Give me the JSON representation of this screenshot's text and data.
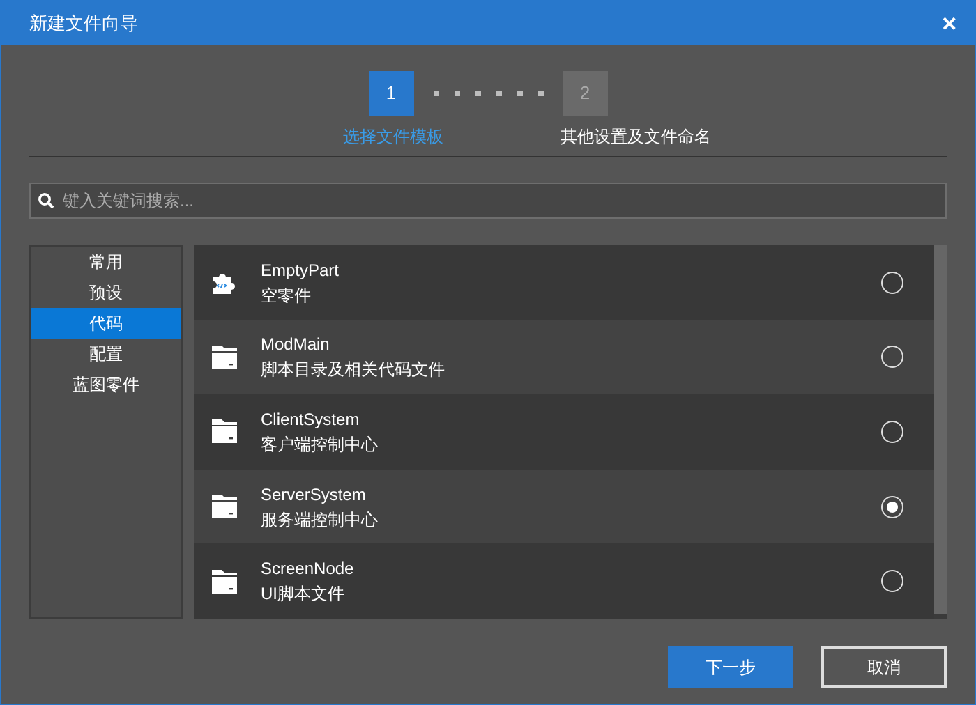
{
  "window": {
    "title": "新建文件向导",
    "close": "✕"
  },
  "steps": [
    {
      "number": "1",
      "label": "选择文件模板",
      "selected": true
    },
    {
      "number": "2",
      "label": "其他设置及文件命名",
      "selected": false
    }
  ],
  "search": {
    "placeholder": "键入关键词搜索..."
  },
  "categories": [
    {
      "label": "常用",
      "selected": false
    },
    {
      "label": "预设",
      "selected": false
    },
    {
      "label": "代码",
      "selected": true
    },
    {
      "label": "配置",
      "selected": false
    },
    {
      "label": "蓝图零件",
      "selected": false
    }
  ],
  "templates": [
    {
      "kind": "component",
      "name": "EmptyPart",
      "description": "空零件",
      "selected": false
    },
    {
      "kind": "folder",
      "name": "ModMain",
      "description": "脚本目录及相关代码文件",
      "selected": false
    },
    {
      "kind": "folder",
      "name": "ClientSystem",
      "description": "客户端控制中心",
      "selected": false
    },
    {
      "kind": "folder",
      "name": "ServerSystem",
      "description": "服务端控制中心",
      "selected": true
    },
    {
      "kind": "folder",
      "name": "ScreenNode",
      "description": "UI脚本文件",
      "selected": false
    }
  ],
  "buttons": [
    {
      "kind": "primary",
      "label": "下一步"
    },
    {
      "kind": "secondary",
      "label": "取消"
    }
  ]
}
